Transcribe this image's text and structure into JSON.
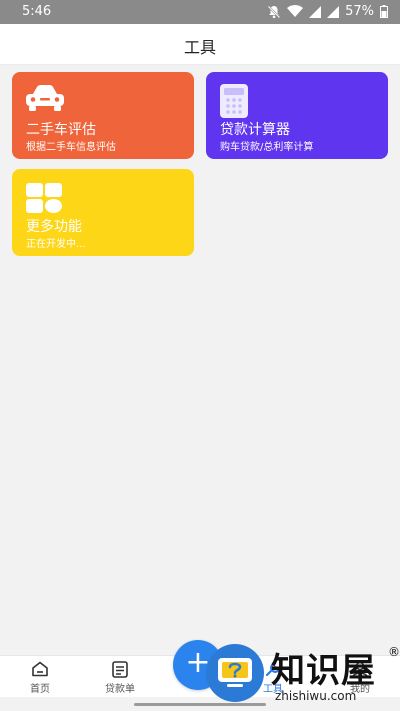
{
  "status": {
    "time": "5:46",
    "battery": "57%"
  },
  "header": {
    "title": "工具"
  },
  "cards": [
    {
      "title": "二手车评估",
      "subtitle": "根据二手车信息评估",
      "icon": "car-icon",
      "color": "#ef643a"
    },
    {
      "title": "贷款计算器",
      "subtitle": "购车贷款/总利率计算",
      "icon": "calculator-icon",
      "color": "#5f35ef"
    },
    {
      "title": "更多功能",
      "subtitle": "正在开发中...",
      "icon": "grid-icon",
      "color": "#fdd618"
    }
  ],
  "nav": [
    {
      "label": "首页",
      "icon": "home-icon"
    },
    {
      "label": "贷款单",
      "icon": "document-icon"
    },
    {
      "label": "工具",
      "icon": "tools-icon",
      "active": true
    },
    {
      "label": "我的",
      "icon": "user-icon"
    }
  ],
  "fab": {
    "label": "+"
  },
  "watermark": {
    "brand": "知识屋",
    "reg": "®",
    "domain": "zhishiwu.com"
  },
  "colors": {
    "accent": "#2b84ee",
    "active_nav": "#2b78e4"
  }
}
